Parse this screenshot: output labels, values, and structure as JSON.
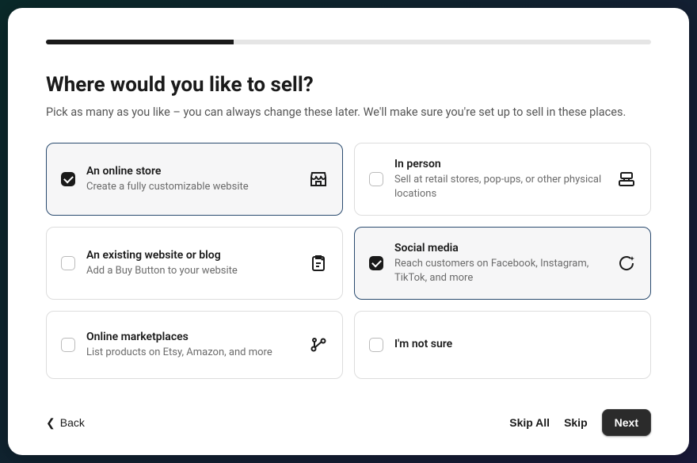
{
  "progress": {
    "percent": 31
  },
  "heading": "Where would you like to sell?",
  "subheading": "Pick as many as you like – you can always change these later. We'll make sure you're set up to sell in these places.",
  "options": [
    {
      "id": "online-store",
      "title": "An online store",
      "desc": "Create a fully customizable website",
      "icon": "storefront-icon",
      "selected": true
    },
    {
      "id": "in-person",
      "title": "In person",
      "desc": "Sell at retail stores, pop-ups, or other physical locations",
      "icon": "register-icon",
      "selected": false
    },
    {
      "id": "existing-site",
      "title": "An existing website or blog",
      "desc": "Add a Buy Button to your website",
      "icon": "clipboard-icon",
      "selected": false
    },
    {
      "id": "social-media",
      "title": "Social media",
      "desc": "Reach customers on Facebook, Instagram, TikTok, and more",
      "icon": "chat-icon",
      "selected": true
    },
    {
      "id": "marketplaces",
      "title": "Online marketplaces",
      "desc": "List products on Etsy, Amazon, and more",
      "icon": "network-icon",
      "selected": false
    },
    {
      "id": "not-sure",
      "title": "I'm not sure",
      "desc": "",
      "icon": "",
      "selected": false
    }
  ],
  "footer": {
    "back": "Back",
    "skip_all": "Skip All",
    "skip": "Skip",
    "next": "Next"
  }
}
